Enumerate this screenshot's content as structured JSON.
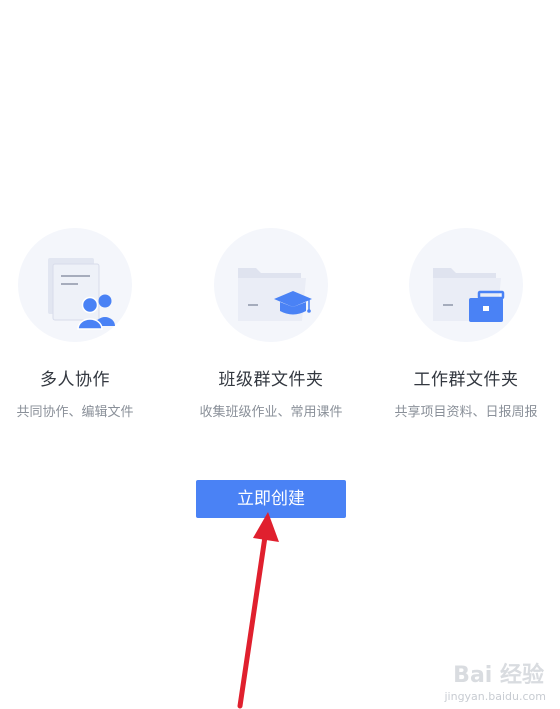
{
  "features": [
    {
      "title": "多人协作",
      "description": "共同协作、编辑文件",
      "icon": "collaboration-icon"
    },
    {
      "title": "班级群文件夹",
      "description": "收集班级作业、常用课件",
      "icon": "class-folder-icon"
    },
    {
      "title": "工作群文件夹",
      "description": "共享项目资料、日报周报",
      "icon": "work-folder-icon"
    }
  ],
  "create_button": {
    "label": "立即创建"
  },
  "annotation": {
    "arrow_color": "#e0202e"
  },
  "watermark": {
    "logo": "Bai 经验",
    "url": "jingyan.baidu.com"
  },
  "colors": {
    "accent": "#4a82f5",
    "circle_bg": "#f4f6fb",
    "folder_light": "#dfe3ef",
    "folder_mid": "#e9ecf5"
  }
}
